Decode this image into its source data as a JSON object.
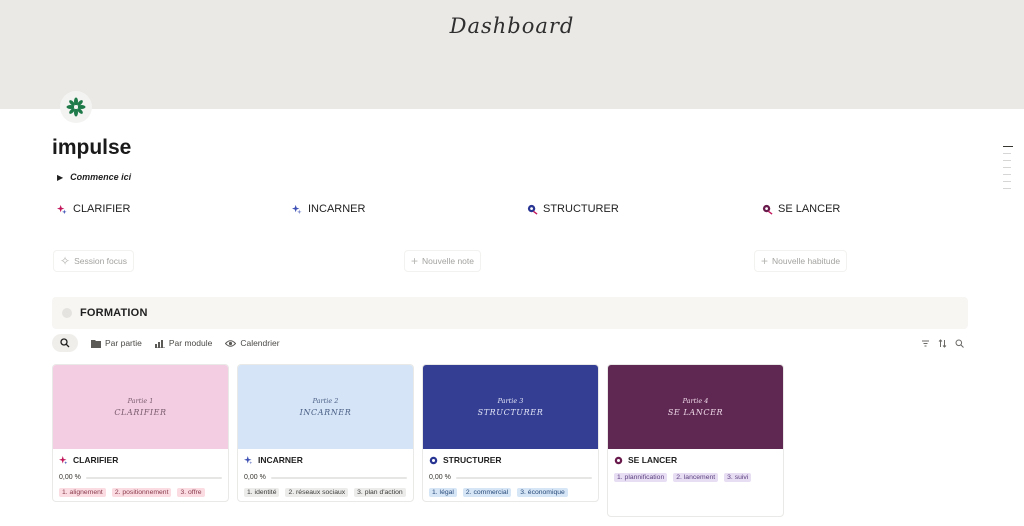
{
  "cover": {
    "title": "Dashboard"
  },
  "page": {
    "icon": "green-flower-icon",
    "title": "impulse"
  },
  "toggle": {
    "label": "Commence ici"
  },
  "modules": [
    {
      "label": "CLARIFIER",
      "icon": "sparkle-icon",
      "color": "#c2185b"
    },
    {
      "label": "INCARNER",
      "icon": "sparkle-icon",
      "color": "#3f51b5"
    },
    {
      "label": "STRUCTURER",
      "icon": "gear-icon",
      "color": "#283593"
    },
    {
      "label": "SE LANCER",
      "icon": "rocket-icon",
      "color": "#6a1b4d"
    }
  ],
  "quick_actions": {
    "session": "Session focus",
    "note": "Nouvelle note",
    "habit": "Nouvelle habitude"
  },
  "callout": {
    "label": "FORMATION"
  },
  "views": {
    "tab1": "Par partie",
    "tab2": "Par module",
    "tab3": "Calendrier"
  },
  "cards": [
    {
      "cover_part": "Partie 1",
      "cover_name": "CLARIFIER",
      "cover_bg": "#f3cde2",
      "cover_fg": "#7a5b6e",
      "title": "CLARIFIER",
      "progress": "0,00 %",
      "tags": [
        "1. alignement",
        "2. positionnement",
        "3. offre"
      ],
      "tag_bg": "#fadce2",
      "tag_fg": "#8a3a4b"
    },
    {
      "cover_part": "Partie 2",
      "cover_name": "INCARNER",
      "cover_bg": "#d5e4f6",
      "cover_fg": "#4a5f86",
      "title": "INCARNER",
      "progress": "0,00 %",
      "tags": [
        "1. identité",
        "2. réseaux sociaux",
        "3. plan d'action"
      ],
      "tag_bg": "#ececea",
      "tag_fg": "#3a3a38"
    },
    {
      "cover_part": "Partie 3",
      "cover_name": "STRUCTURER",
      "cover_bg": "#343f93",
      "cover_fg": "#e3e6f8",
      "title": "STRUCTURER",
      "progress": "0,00 %",
      "tags": [
        "1. légal",
        "2. commercial",
        "3. économique"
      ],
      "tag_bg": "#d6e6f7",
      "tag_fg": "#284a78"
    },
    {
      "cover_part": "Partie 4",
      "cover_name": "SE LANCER",
      "cover_bg": "#5e2853",
      "cover_fg": "#f1dbe9",
      "title": "SE LANCER",
      "progress": "",
      "tags": [
        "1. plannification",
        "2. lancement",
        "3. suivi"
      ],
      "tag_bg": "#e8def4",
      "tag_fg": "#5a3f7e"
    }
  ]
}
